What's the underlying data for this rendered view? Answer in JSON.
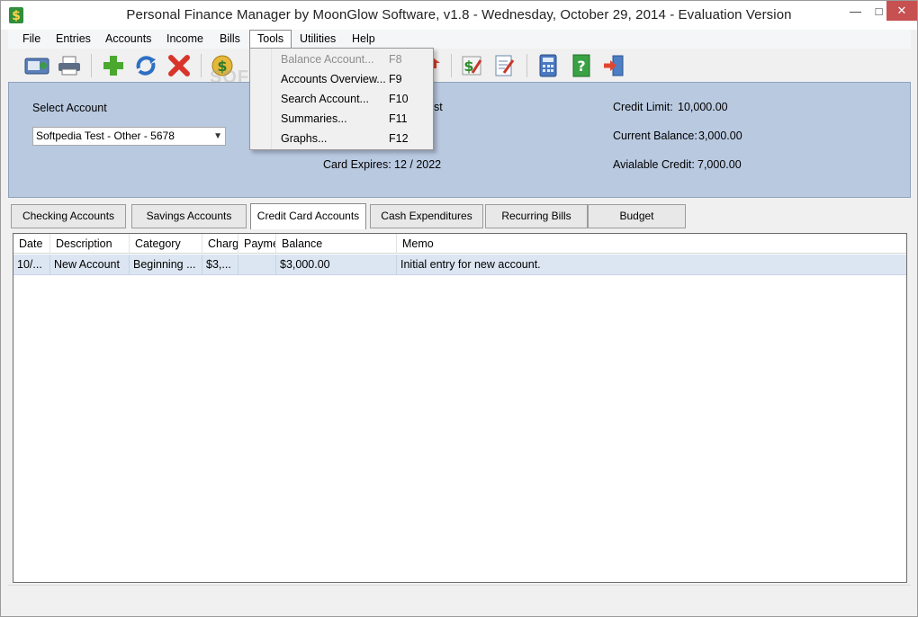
{
  "window": {
    "title": "Personal Finance Manager by MoonGlow Software, v1.8  -  Wednesday, October 29, 2014  -  Evaluation Version",
    "min_glyph": "—",
    "max_glyph": "□",
    "close_glyph": "✕"
  },
  "menu": [
    "File",
    "Entries",
    "Accounts",
    "Income",
    "Bills",
    "Tools",
    "Utilities",
    "Help"
  ],
  "tools_menu": [
    {
      "label": "Balance Account...",
      "key": "F8",
      "enabled": false
    },
    {
      "label": "Accounts Overview...",
      "key": "F9",
      "enabled": true
    },
    {
      "label": "Search Account...",
      "key": "F10",
      "enabled": true
    },
    {
      "label": "Summaries...",
      "key": "F11",
      "enabled": true
    },
    {
      "label": "Graphs...",
      "key": "F12",
      "enabled": true
    }
  ],
  "toolbar": {
    "icons": [
      "accounts-icon",
      "print-icon",
      "add-icon",
      "refresh-icon",
      "delete-icon",
      "money-icon",
      "bill-icon",
      "budget-icon",
      "notepad-icon",
      "calculator-icon",
      "help-icon",
      "exit-icon"
    ]
  },
  "account": {
    "select_label": "Select Account",
    "selected": "Softpedia Test - Other - 5678",
    "partial_label": "st",
    "card_expires_label": "Card Expires:",
    "card_expires_value": "12 / 2022",
    "credit_limit_label": "Credit Limit:",
    "credit_limit_value": "10,000.00",
    "current_balance_label": "Current Balance:",
    "current_balance_value": "3,000.00",
    "available_credit_label": "Avialable Credit:",
    "available_credit_value": "7,000.00"
  },
  "tabs": [
    "Checking Accounts",
    "Savings Accounts",
    "Credit Card Accounts",
    "Cash Expenditures",
    "Recurring Bills",
    "Budget"
  ],
  "active_tab": "Credit Card Accounts",
  "grid": {
    "columns": [
      "Date",
      "Description",
      "Category",
      "Charg",
      "Payme",
      "Balance",
      "Memo"
    ],
    "rows": [
      [
        "10/...",
        "New Account",
        "Beginning ...",
        "$3,...",
        "",
        "$3,000.00",
        "Initial entry for new account."
      ]
    ]
  },
  "watermark": "SOFTPEDIA",
  "colors": {
    "panel": "#b9c9e0",
    "selected_row": "#dce6f2",
    "close_button": "#c75050"
  }
}
